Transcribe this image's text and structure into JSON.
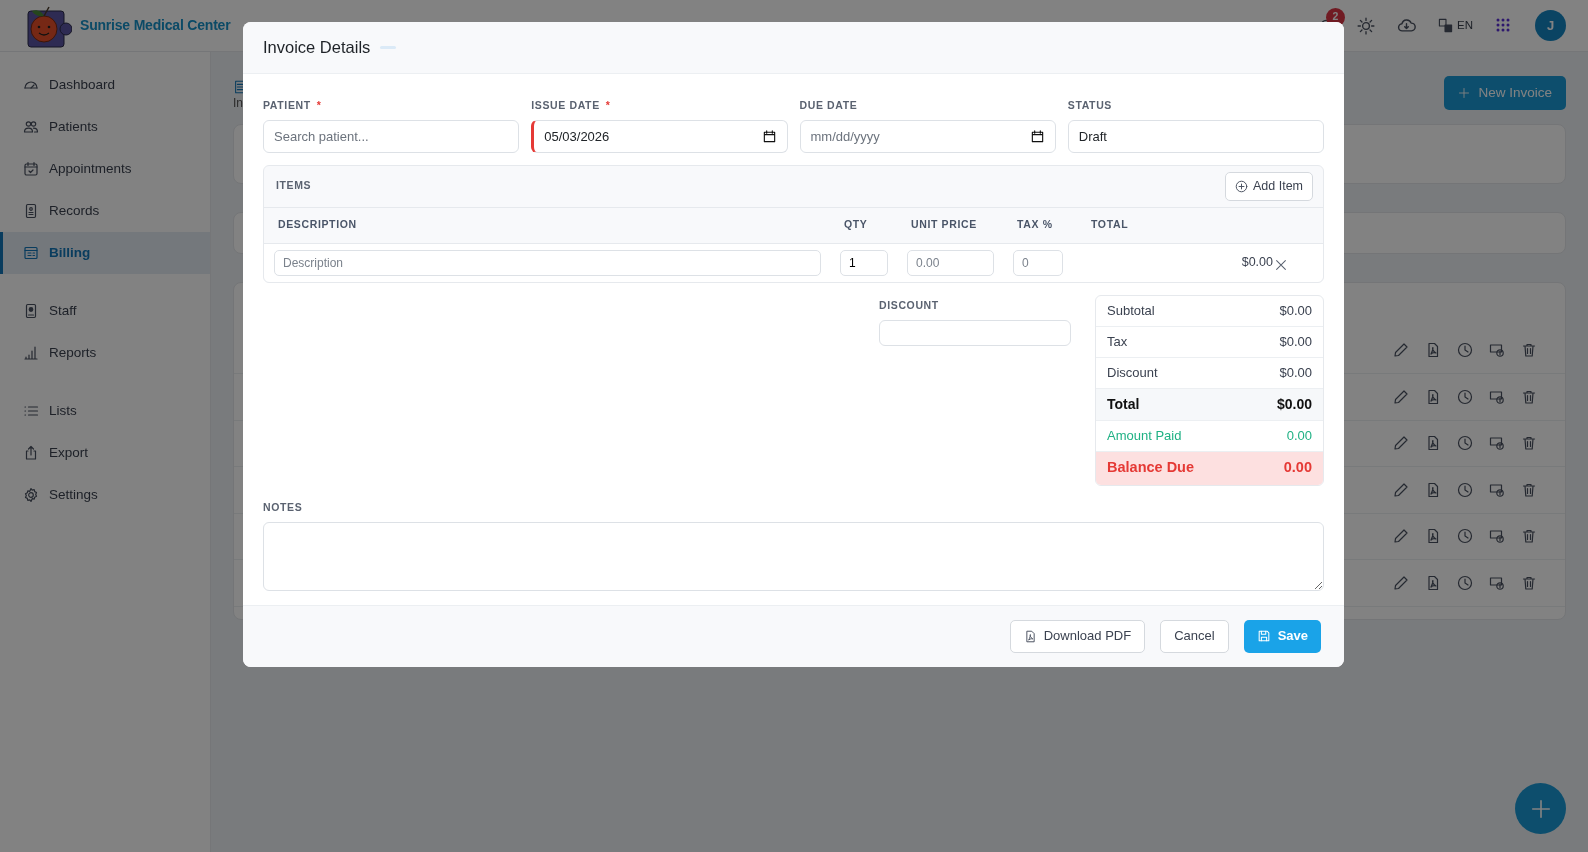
{
  "app": {
    "brand": "Sunrise Medical Center",
    "notification_count": "2",
    "language": "EN",
    "avatar_initial": "J"
  },
  "sidebar": {
    "sections": [
      {
        "items": [
          {
            "label": "Dashboard",
            "selected": false
          },
          {
            "label": "Patients",
            "selected": false
          },
          {
            "label": "Appointments",
            "selected": false
          },
          {
            "label": "Records",
            "selected": false
          },
          {
            "label": "Billing",
            "selected": true
          }
        ]
      },
      {
        "items": [
          {
            "label": "Staff",
            "selected": false
          },
          {
            "label": "Reports",
            "selected": false
          }
        ]
      },
      {
        "items": [
          {
            "label": "Lists",
            "selected": false
          },
          {
            "label": "Export",
            "selected": false
          },
          {
            "label": "Settings",
            "selected": false
          }
        ]
      }
    ]
  },
  "page": {
    "tab_label": "In",
    "new_button": "New Invoice",
    "rows": [
      {
        "kind": "invoice"
      },
      {
        "kind": "invoice"
      },
      {
        "kind": "invoice"
      },
      {
        "kind": "invoice"
      },
      {
        "kind": "invoice"
      },
      {
        "kind": "invoice"
      }
    ]
  },
  "modal": {
    "title": "Invoice Details",
    "fields": [
      {
        "kind": "text",
        "label": "PATIENT",
        "required_mark": "*",
        "placeholder": "Search patient...",
        "invalid": false
      },
      {
        "kind": "date",
        "label": "ISSUE DATE",
        "required_mark": "*",
        "value": "05/03/2026",
        "invalid": true
      },
      {
        "kind": "date",
        "label": "DUE DATE",
        "placeholder": "mm/dd/yyyy",
        "invalid": false
      },
      {
        "kind": "select",
        "label": "STATUS",
        "value": "Draft",
        "invalid": false
      }
    ],
    "items": {
      "title": "ITEMS",
      "add_button": "Add Item",
      "columns": [
        "DESCRIPTION",
        "QTY",
        "UNIT PRICE",
        "TAX %",
        "TOTAL"
      ],
      "rows": [
        {
          "description_placeholder": "Description",
          "qty": "1",
          "unit_price_placeholder": "0.00",
          "tax_placeholder": "0",
          "total": "$0.00"
        }
      ]
    },
    "discount": {
      "label": "DISCOUNT"
    },
    "summary": [
      {
        "kind": "line",
        "label": "Subtotal",
        "value": "$0.00"
      },
      {
        "kind": "line",
        "label": "Tax",
        "value": "$0.00"
      },
      {
        "kind": "line",
        "label": "Discount",
        "value": "$0.00"
      },
      {
        "kind": "total",
        "label": "Total",
        "value": "$0.00"
      },
      {
        "kind": "paid",
        "label": "Amount Paid",
        "value": "0.00"
      },
      {
        "kind": "balance",
        "label": "Balance Due",
        "value": "0.00"
      }
    ],
    "notes": {
      "label": "NOTES"
    },
    "buttons": [
      {
        "kind": "pdf",
        "label": "Download PDF"
      },
      {
        "kind": "cancel",
        "label": "Cancel"
      },
      {
        "kind": "save",
        "label": "Save"
      }
    ]
  }
}
